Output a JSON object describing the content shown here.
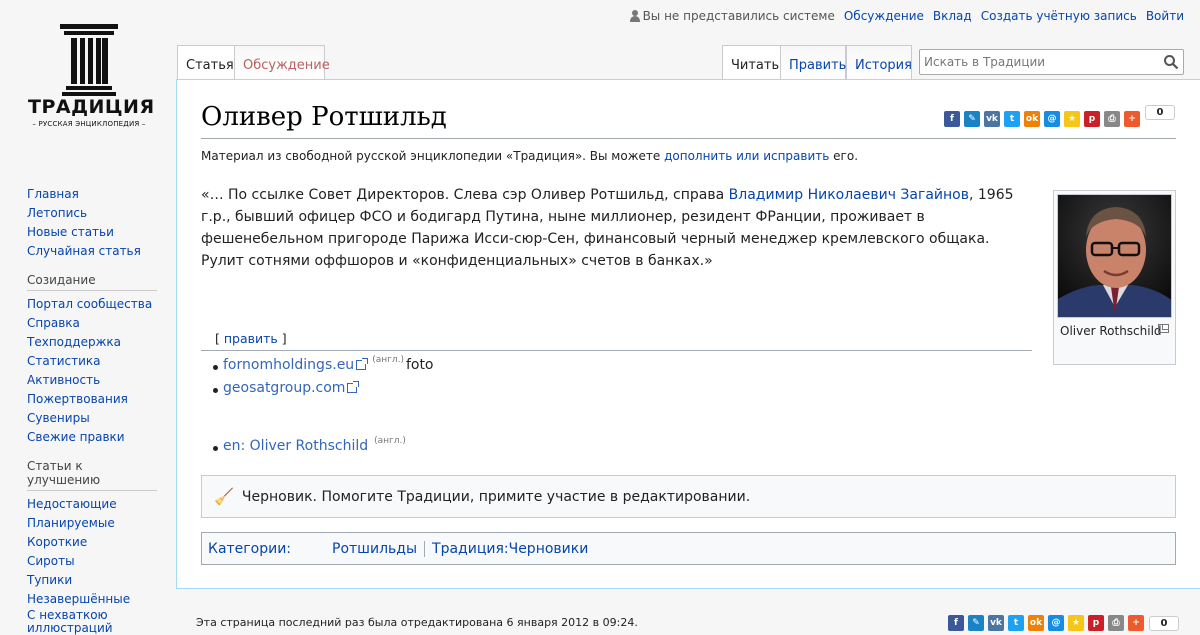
{
  "personal": {
    "not_logged": "Вы не представились системе",
    "talk": "Обсуждение",
    "contributions": "Вклад",
    "create_account": "Создать учётную запись",
    "login": "Войти"
  },
  "logo": {
    "title": "ТРАДИЦИЯ",
    "subtitle": "– РУССКАЯ ЭНЦИКЛОПЕДИЯ –"
  },
  "sidebar": {
    "nav": [
      "Главная",
      "Летопись",
      "Новые статьи",
      "Случайная статья"
    ],
    "creation_heading": "Созидание",
    "creation": [
      "Портал сообщества",
      "Справка",
      "Техподдержка",
      "Статистика",
      "Активность",
      "Пожертвования",
      "Сувениры",
      "Свежие правки"
    ],
    "improve_heading": "Статьи к улучшению",
    "improve": [
      "Недостающие",
      "Планируемые",
      "Короткие",
      "Сироты",
      "Тупики",
      "Незавершённые",
      "С нехваткою иллюстраций"
    ]
  },
  "tabs": {
    "article": "Статья",
    "talk": "Обсуждение",
    "read": "Читать",
    "edit": "Править",
    "history": "История"
  },
  "search": {
    "placeholder": "Искать в Традиции"
  },
  "article": {
    "title": "Оливер Ротшильд",
    "site_sub_before": "Материал из свободной русской энциклопедии «Традиция». Вы можете ",
    "site_sub_link": "дополнить или исправить",
    "site_sub_after": " его.",
    "lead_before": "«… По ссылке Совет Директоров. Слева сэр Оливер Ротшильд, справа ",
    "lead_link": "Владимир Николаевич Загайнов",
    "lead_after": ", 1965 г.р., бывший офицер ФСО и бодигард Путина, ныне миллионер, резидент ФРанции, проживает в фешенебельном пригороде Парижа Исси-сюр-Сен, финансовый черный менеджер кремлевского общака. Рулит сотнями оффшоров и «конфиденциальных» счетов в банках.»",
    "image_caption": "Oliver Rothschild",
    "edit_section": "править",
    "links": [
      {
        "text": "fornomholdings.eu",
        "lang": "(англ.)",
        "after": " foto"
      },
      {
        "text": "geosatgroup.com",
        "lang": "",
        "after": ""
      },
      {
        "text": "en: Oliver Rothschild",
        "lang": "(англ.)",
        "after": ""
      }
    ],
    "draft_notice": "Черновик. Помогите Традиции, примите участие в редактировании.",
    "categories_label": "Категории:",
    "categories": [
      "Ротшильды",
      "Традиция:Черновики"
    ]
  },
  "share": {
    "buttons": [
      {
        "name": "facebook",
        "glyph": "f",
        "color": "#3b5998"
      },
      {
        "name": "livejournal",
        "glyph": "✎",
        "color": "#1a83c6"
      },
      {
        "name": "vkontakte",
        "glyph": "vk",
        "color": "#4c75a3"
      },
      {
        "name": "twitter",
        "glyph": "t",
        "color": "#1da1f2"
      },
      {
        "name": "odnoklassniki",
        "glyph": "ok",
        "color": "#ee8208"
      },
      {
        "name": "mailru",
        "glyph": "@",
        "color": "#168de2"
      },
      {
        "name": "favorites",
        "glyph": "★",
        "color": "#f5c518"
      },
      {
        "name": "pinterest",
        "glyph": "p",
        "color": "#cb2027"
      },
      {
        "name": "print",
        "glyph": "⎙",
        "color": "#888888"
      },
      {
        "name": "more",
        "glyph": "+",
        "color": "#ef5a2c"
      }
    ],
    "count": "0"
  },
  "footer": {
    "last_modified": "Эта страница последний раз была отредактирована 6 января 2012 в 09:24."
  }
}
